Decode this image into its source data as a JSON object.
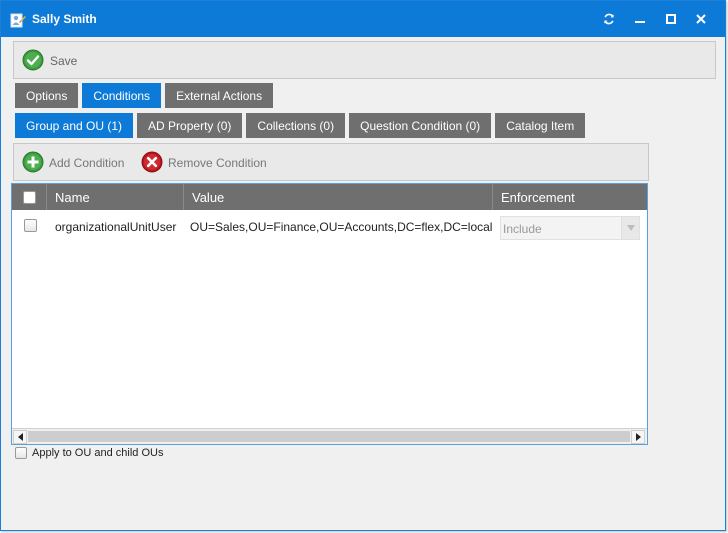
{
  "window": {
    "title": "Sally Smith"
  },
  "toolbar": {
    "save_label": "Save"
  },
  "tabs": [
    {
      "label": "Options",
      "active": false
    },
    {
      "label": "Conditions",
      "active": true
    },
    {
      "label": "External Actions",
      "active": false
    }
  ],
  "subtabs": [
    {
      "label": "Group and OU (1)",
      "active": true
    },
    {
      "label": "AD Property (0)",
      "active": false
    },
    {
      "label": "Collections (0)",
      "active": false
    },
    {
      "label": "Question Condition (0)",
      "active": false
    },
    {
      "label": "Catalog Item",
      "active": false
    }
  ],
  "condition_toolbar": {
    "add_label": "Add Condition",
    "remove_label": "Remove Condition"
  },
  "grid": {
    "columns": [
      "Name",
      "Value",
      "Enforcement"
    ],
    "rows": [
      {
        "name": "organizationalUnitUser",
        "value": "OU=Sales,OU=Finance,OU=Accounts,DC=flex,DC=local",
        "enforcement": "Include"
      }
    ]
  },
  "apply_option": {
    "label": "Apply to OU and child OUs",
    "checked": false
  },
  "colors": {
    "accent": "#0c7ad6",
    "tab_inactive": "#6f6f6f",
    "header_bg": "#6f6f6f"
  }
}
